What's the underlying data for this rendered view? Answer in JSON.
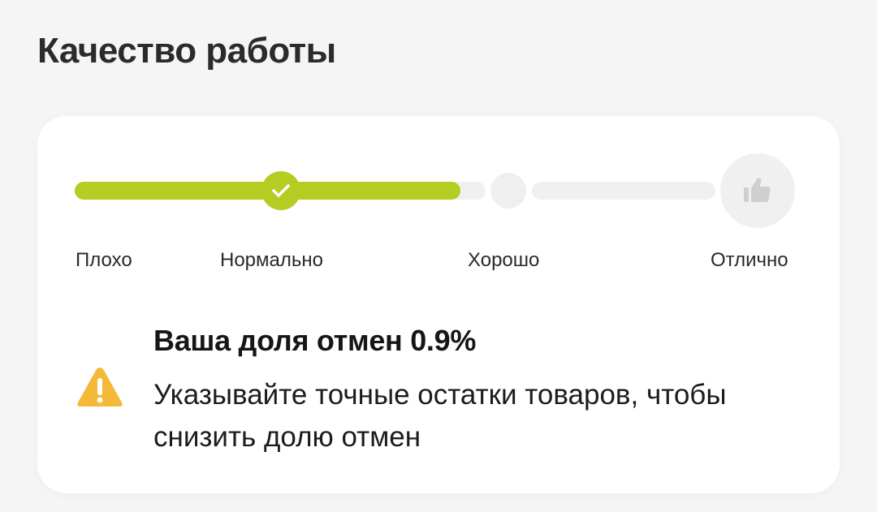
{
  "page": {
    "title": "Качество работы"
  },
  "quality": {
    "progress_percent": 54,
    "current_level": "Нормально",
    "levels": [
      {
        "label": "Плохо",
        "icon": "none"
      },
      {
        "label": "Нормально",
        "icon": "checkmark-icon"
      },
      {
        "label": "Хорошо",
        "icon": "none"
      },
      {
        "label": "Отлично",
        "icon": "thumbs-up-icon"
      }
    ],
    "colors": {
      "accent": "#b5cc22",
      "inactive": "#f0f0f0",
      "warning": "#f5b93a"
    }
  },
  "notice": {
    "icon": "warning-icon",
    "title": "Ваша доля отмен 0.9%",
    "text": "Указывайте точные остатки товаров, чтобы снизить долю отмен"
  }
}
